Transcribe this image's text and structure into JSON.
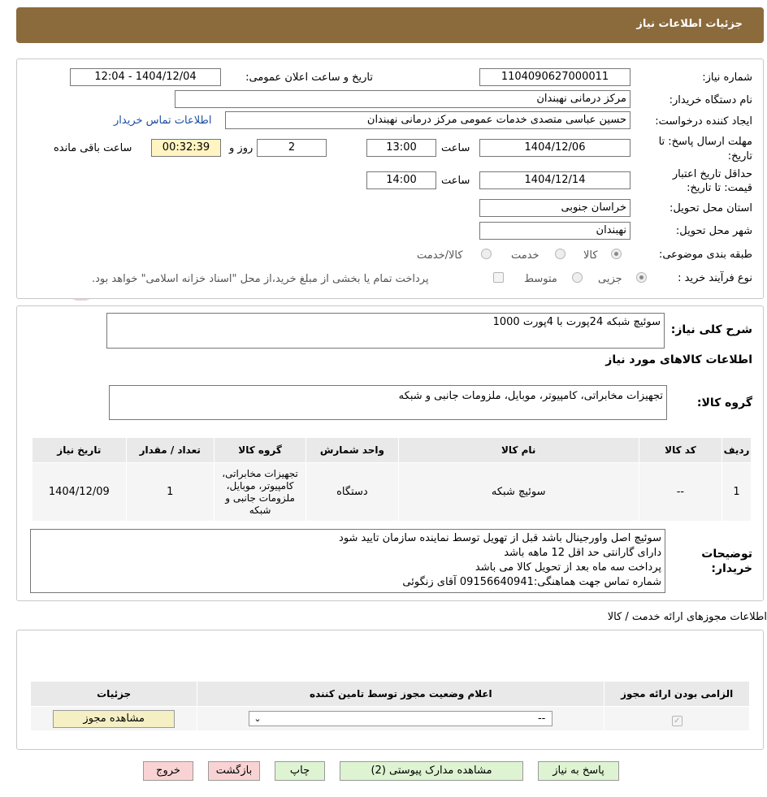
{
  "header": {
    "title": "جزئيات اطلاعات نياز"
  },
  "form": {
    "need_number_label": "شماره نیاز:",
    "need_number": "1104090627000011",
    "announce_label": "تاریخ و ساعت اعلان عمومی:",
    "announce_value": "1404/12/04 - 12:04",
    "buyer_org_label": "نام دستگاه خریدار:",
    "buyer_org": "مرکز درمانی نهبندان",
    "requester_label": "ایجاد کننده درخواست:",
    "requester": "حسین عباسی متصدی خدمات عمومی مرکز درمانی نهبندان",
    "contact_link": "اطلاعات تماس خریدار",
    "deadline_label_1": "مهلت ارسال پاسخ: تا",
    "deadline_label_2": "تاریخ:",
    "deadline_date": "1404/12/06",
    "time_label": "ساعت",
    "deadline_time": "13:00",
    "days_value": "2",
    "days_label": "روز و",
    "remaining_time": "00:32:39",
    "remaining_label": "ساعت باقی مانده",
    "validity_label_1": "حداقل تاریخ اعتبار",
    "validity_label_2": "قیمت: تا تاریخ:",
    "validity_date": "1404/12/14",
    "validity_time": "14:00",
    "province_label": "استان محل تحویل:",
    "province": "خراسان جنوبی",
    "city_label": "شهر محل تحویل:",
    "city": "نهبندان",
    "category_label": "طبقه بندی موضوعی:",
    "category_options": [
      "کالا",
      "خدمت",
      "کالا/خدمت"
    ],
    "process_label": "نوع فرآیند خرید :",
    "process_options": [
      "جزیی",
      "متوسط"
    ],
    "payment_note": "پرداخت تمام یا بخشی از مبلغ خرید،از محل \"اسناد خزانه اسلامی\" خواهد بود."
  },
  "description": {
    "label": "شرح کلی نیاز:",
    "value": "سوئیچ شبکه 24پورت با 4پورت 1000",
    "goods_section_title": "اطلاعات کالاهای مورد نیاز",
    "group_label": "گروه کالا:",
    "group_value": "تجهیزات مخابراتی، کامپیوتر، موبایل، ملزومات جانبی و شبکه"
  },
  "goods_table": {
    "headers": [
      "ردیف",
      "کد کالا",
      "نام کالا",
      "واحد شمارش",
      "گروه کالا",
      "تعداد / مقدار",
      "تاریخ نیاز"
    ],
    "rows": [
      {
        "row": "1",
        "code": "--",
        "name": "سوئیچ شبکه",
        "unit": "دستگاه",
        "group": "تجهیزات مخابراتی، کامپیوتر، موبایل، ملزومات جانبی و شبکه",
        "qty": "1",
        "date": "1404/12/09"
      }
    ]
  },
  "buyer_notes": {
    "label_1": "توضیحات",
    "label_2": "خریدار:",
    "lines": [
      "سوئیچ اصل واورجینال باشد قبل از تهویل توسط نماینده سازمان تایید شود",
      "دارای گارانتی حد اقل 12 ماهه باشد",
      "پرداخت سه ماه بعد از تحویل کالا می باشد",
      "شماره تماس جهت هماهنگی:09156640941  آقای زنگوئی"
    ]
  },
  "permits": {
    "title": "اطلاعات مجوزهای ارائه خدمت / کالا",
    "headers": [
      "الزامی بودن ارائه مجوز",
      "اعلام وضعیت مجوز توسط تامین کننده",
      "جزئیات"
    ],
    "select_value": "--",
    "view_button": "مشاهده مجوز"
  },
  "buttons": {
    "reply": "پاسخ به نیاز",
    "attachments": "مشاهده مدارک پیوستی (2)",
    "print": "چاپ",
    "back": "بازگشت",
    "exit": "خروج"
  },
  "colors": {
    "header_bg": "#8b6a3c",
    "remaining_bg": "#fff4c2",
    "button_green": "#ddf3d2",
    "button_pink": "#f9d3d3",
    "button_yellow": "#f5f0c4"
  }
}
